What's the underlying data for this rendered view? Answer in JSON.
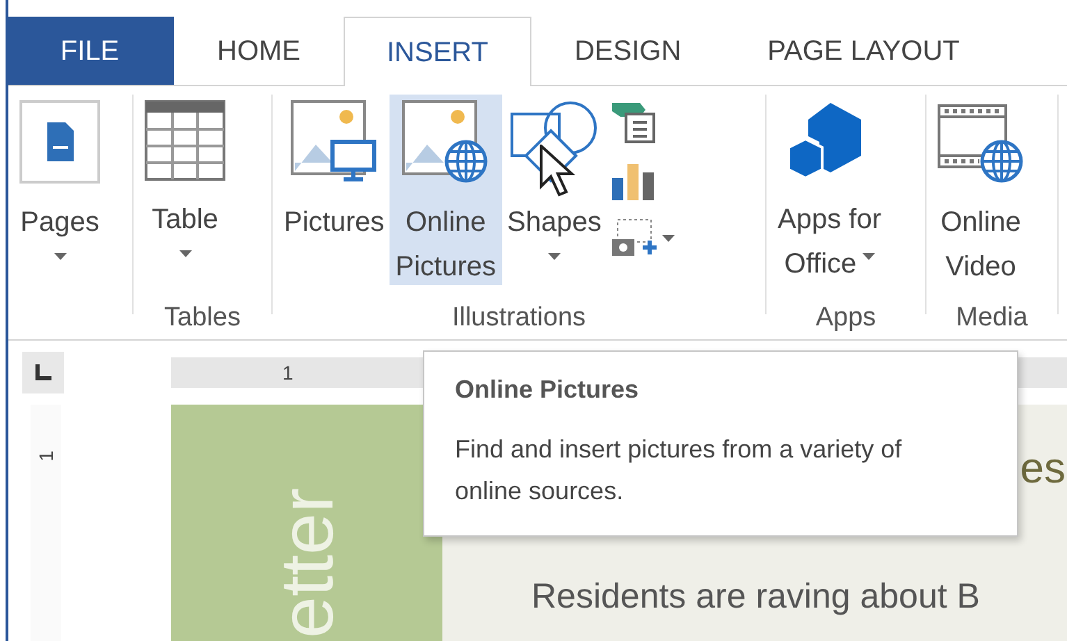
{
  "tabs": [
    {
      "label": "FILE",
      "kind": "file",
      "selected": false
    },
    {
      "label": "HOME",
      "kind": "tab",
      "selected": false
    },
    {
      "label": "INSERT",
      "kind": "tab",
      "selected": true
    },
    {
      "label": "DESIGN",
      "kind": "tab",
      "selected": false
    },
    {
      "label": "PAGE LAYOUT",
      "kind": "tab",
      "selected": false
    }
  ],
  "groups": [
    {
      "buttons": [
        {
          "kind": "large",
          "lines": [
            "Pages"
          ],
          "dropdown": true,
          "highlighted": false
        }
      ]
    },
    {
      "label": "Tables",
      "buttons": [
        {
          "kind": "large",
          "lines": [
            "Table"
          ],
          "dropdown": true,
          "highlighted": false
        }
      ]
    },
    {
      "label": "Illustrations",
      "buttons": [
        {
          "kind": "large",
          "lines": [
            "Pictures"
          ],
          "dropdown": false,
          "highlighted": false
        },
        {
          "kind": "large",
          "lines": [
            "Online",
            "Pictures"
          ],
          "dropdown": false,
          "highlighted": true
        },
        {
          "kind": "large",
          "lines": [
            "Shapes"
          ],
          "dropdown": true,
          "highlighted": false
        },
        {
          "kind": "small",
          "dropdown": false,
          "highlighted": false
        },
        {
          "kind": "small",
          "dropdown": false,
          "highlighted": false
        },
        {
          "kind": "small",
          "dropdown": true,
          "highlighted": false
        }
      ]
    },
    {
      "label": "Apps",
      "buttons": [
        {
          "kind": "large",
          "lines": [
            "Apps for",
            "Office"
          ],
          "dropdown": true,
          "highlighted": false
        }
      ]
    },
    {
      "label": "Media",
      "buttons": [
        {
          "kind": "large",
          "lines": [
            "Online",
            "Video"
          ],
          "dropdown": false,
          "highlighted": false
        }
      ]
    }
  ],
  "ruler": {
    "horizontal_mark": "1",
    "vertical_mark": "1"
  },
  "document": {
    "side_text": "etter",
    "heading": "es",
    "body": "Residents are raving about B"
  },
  "tooltip": {
    "title": "Online Pictures",
    "description": "Find and insert pictures from a variety of online sources."
  }
}
